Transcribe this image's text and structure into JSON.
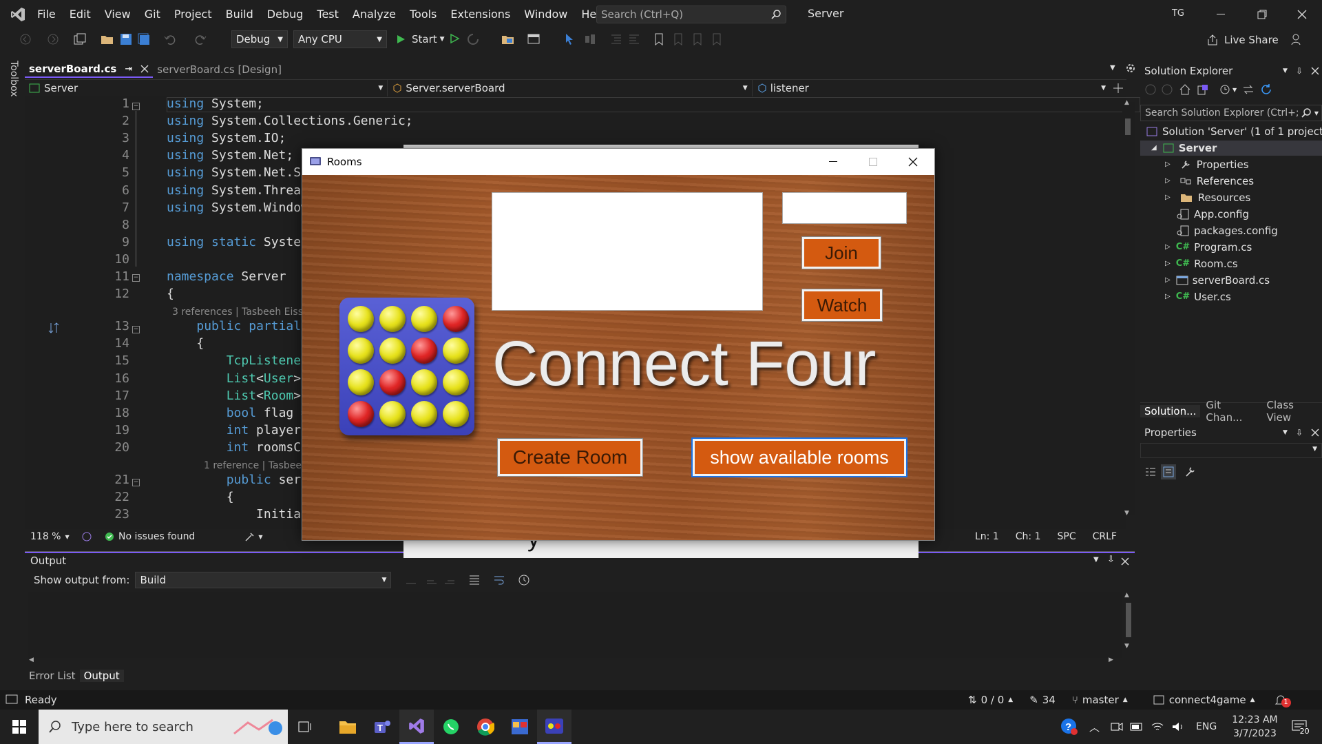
{
  "menu": [
    "File",
    "Edit",
    "View",
    "Git",
    "Project",
    "Build",
    "Debug",
    "Test",
    "Analyze",
    "Tools",
    "Extensions",
    "Window",
    "Help"
  ],
  "search": {
    "placeholder": "Search (Ctrl+Q)"
  },
  "solution_name": "Server",
  "user_initials": "TG",
  "toolbar": {
    "config": "Debug",
    "platform": "Any CPU",
    "start_label": "Start",
    "live_share": "Live Share"
  },
  "toolbox_label": "Toolbox",
  "tabs": [
    {
      "label": "serverBoard.cs",
      "pin": "⇥"
    },
    {
      "label": "serverBoard.cs [Design]"
    }
  ],
  "navbar": {
    "project": "Server",
    "class": "Server.serverBoard",
    "member": "listener"
  },
  "code_lines": [
    {
      "n": "1",
      "t": "using System;"
    },
    {
      "n": "2",
      "t": "using System.Collections.Generic;"
    },
    {
      "n": "3",
      "t": "using System.IO;"
    },
    {
      "n": "4",
      "t": "using System.Net;"
    },
    {
      "n": "5",
      "t": "using System.Net.Sock"
    },
    {
      "n": "6",
      "t": "using System.Threadin"
    },
    {
      "n": "7",
      "t": "using System.Windows."
    },
    {
      "n": "8",
      "t": ""
    },
    {
      "n": "9",
      "t": "using static System.W"
    },
    {
      "n": "10",
      "t": ""
    },
    {
      "n": "11",
      "t": "namespace Server"
    },
    {
      "n": "12",
      "t": "{"
    },
    {
      "n": "13",
      "t": "    public partial cl"
    },
    {
      "n": "14",
      "t": "    {"
    },
    {
      "n": "15",
      "t": "        TcpListener l"
    },
    {
      "n": "16",
      "t": "        List<User> us"
    },
    {
      "n": "17",
      "t": "        List<Room> av"
    },
    {
      "n": "18",
      "t": "        bool flag = t"
    },
    {
      "n": "19",
      "t": "        int playerId;"
    },
    {
      "n": "20",
      "t": "        int roomsCour"
    },
    {
      "n": "21",
      "t": "        public server"
    },
    {
      "n": "22",
      "t": "        {"
    },
    {
      "n": "23",
      "t": "            Initializ"
    }
  ],
  "codelens": {
    "refs3": "3 references | Tasbeeh Eiss",
    "refs1": "1 reference | Tasbee"
  },
  "editor_status": {
    "zoom": "118 %",
    "issues": "No issues found",
    "ln": "Ln: 1",
    "ch": "Ch: 1",
    "spc": "SPC",
    "crlf": "CRLF"
  },
  "output": {
    "title": "Output",
    "show_from_label": "Show output from:",
    "source": "Build"
  },
  "bottom_tabs": [
    "Error List",
    "Output"
  ],
  "solution_explorer": {
    "title": "Solution Explorer",
    "search_placeholder": "Search Solution Explorer (Ctrl+;",
    "items": [
      {
        "label": "Solution 'Server' (1 of 1 project)"
      },
      {
        "label": "Server"
      },
      {
        "label": "Properties"
      },
      {
        "label": "References"
      },
      {
        "label": "Resources"
      },
      {
        "label": "App.config"
      },
      {
        "label": "packages.config"
      },
      {
        "label": "Program.cs"
      },
      {
        "label": "Room.cs"
      },
      {
        "label": "serverBoard.cs"
      },
      {
        "label": "User.cs"
      }
    ],
    "tabs": [
      "Solution...",
      "Git Chan...",
      "Class View"
    ]
  },
  "properties": {
    "title": "Properties"
  },
  "statusbar": {
    "ready": "Ready",
    "updown": "0 / 0",
    "edits": "34",
    "branch": "master",
    "repo": "connect4game",
    "notif": "1"
  },
  "taskbar": {
    "search_placeholder": "Type here to search",
    "lang": "ENG",
    "time": "12:23 AM",
    "date": "3/7/2023",
    "notif_count": "20"
  },
  "rooms_window": {
    "title": "Rooms",
    "join": "Join",
    "watch": "Watch",
    "logo": "Connect Four",
    "create": "Create Room",
    "show": "show available rooms",
    "board": [
      "y",
      "y",
      "y",
      "r",
      "y",
      "y",
      "r",
      "y",
      "y",
      "r",
      "y",
      "y",
      "r",
      "y",
      "y",
      "y"
    ]
  },
  "behind_text": "y"
}
